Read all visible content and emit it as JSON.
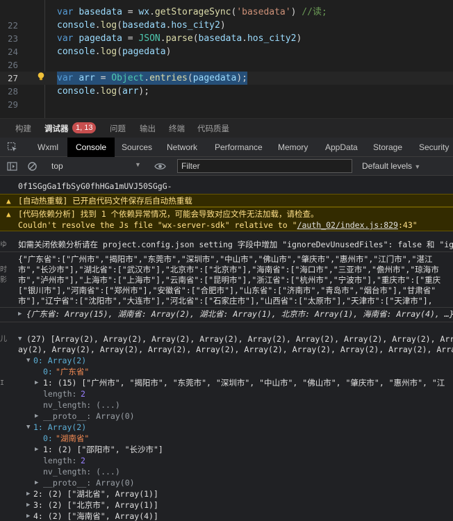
{
  "editor": {
    "lines": [
      {
        "n": "",
        "tokens": [
          [
            "k",
            "var "
          ],
          [
            "v",
            "basedata"
          ],
          [
            "p",
            " = "
          ],
          [
            "v",
            "wx"
          ],
          [
            "p",
            "."
          ],
          [
            "f",
            "getStorageSync"
          ],
          [
            "p",
            "("
          ],
          [
            "s",
            "'basedata'"
          ],
          [
            "p",
            ") "
          ],
          [
            "c",
            "//读;"
          ]
        ]
      },
      {
        "n": "22",
        "tokens": [
          [
            "v",
            "console"
          ],
          [
            "p",
            "."
          ],
          [
            "f",
            "log"
          ],
          [
            "p",
            "("
          ],
          [
            "v",
            "basedata"
          ],
          [
            "p",
            "."
          ],
          [
            "v",
            "hos_city2"
          ],
          [
            "p",
            ")"
          ]
        ]
      },
      {
        "n": "23",
        "tokens": [
          [
            "k",
            "var "
          ],
          [
            "v",
            "pagedata"
          ],
          [
            "p",
            " = "
          ],
          [
            "cls",
            "JSON"
          ],
          [
            "p",
            "."
          ],
          [
            "f",
            "parse"
          ],
          [
            "p",
            "("
          ],
          [
            "v",
            "basedata"
          ],
          [
            "p",
            "."
          ],
          [
            "v",
            "hos_city2"
          ],
          [
            "p",
            ")"
          ]
        ]
      },
      {
        "n": "24",
        "tokens": [
          [
            "v",
            "console"
          ],
          [
            "p",
            "."
          ],
          [
            "f",
            "log"
          ],
          [
            "p",
            "("
          ],
          [
            "v",
            "pagedata"
          ],
          [
            "p",
            ")"
          ]
        ]
      },
      {
        "n": "26",
        "tokens": []
      },
      {
        "n": "27",
        "tokens": [
          [
            "k",
            "var "
          ],
          [
            "v",
            "arr"
          ],
          [
            "p",
            " = "
          ],
          [
            "cls",
            "Object"
          ],
          [
            "p",
            "."
          ],
          [
            "f",
            "entries"
          ],
          [
            "p",
            "("
          ],
          [
            "v",
            "pagedata"
          ],
          [
            "p",
            ");"
          ]
        ]
      },
      {
        "n": "28",
        "tokens": [
          [
            "v",
            "console"
          ],
          [
            "p",
            "."
          ],
          [
            "f",
            "log"
          ],
          [
            "p",
            "("
          ],
          [
            "v",
            "arr"
          ],
          [
            "p",
            ");"
          ]
        ]
      },
      {
        "n": "29",
        "tokens": []
      }
    ]
  },
  "top_tabs": [
    "构建",
    "调试器",
    "问题",
    "输出",
    "终端",
    "代码质量"
  ],
  "badge": "1, 13",
  "dev_tabs": [
    "Wxml",
    "Console",
    "Sources",
    "Network",
    "Performance",
    "Memory",
    "AppData",
    "Storage",
    "Security"
  ],
  "toolbar": {
    "context": "top",
    "filter_placeholder": "Filter",
    "levels": "Default levels"
  },
  "console": {
    "l1": "0f1SGgGa1fbSyG0fhHGa1mUVJ50SGgG-",
    "l2": "[自动热重载] 已开启代码文件保存后自动热重载",
    "l3": "[代码依赖分析] 找到 1 个依赖异常情况，可能会导致对应文件无法加载，请检查。",
    "l4a": "Couldn't resolve the Js file \"wx-server-sdk\" relative to \"",
    "l4link": "/auth_02/index.js:829",
    "l4b": ":43\"",
    "l5": "如需关闭依赖分析请在 project.config.json setting 字段中增加 \"ignoreDevUnusedFiles\": false 和 \"ig",
    "json1": "{\"广东省\":[\"广州市\",\"揭阳市\",\"东莞市\",\"深圳市\",\"中山市\",\"佛山市\",\"肇庆市\",\"惠州市\",\"江门市\",\"湛江",
    "json2": "市\",\"长沙市\"],\"湖北省\":[\"武汉市\"],\"北京市\":[\"北京市\"],\"海南省\":[\"海口市\",\"三亚市\",\"儋州市\",\"琼海市",
    "json3": "市\",\"泸州市\"],\"上海市\":[\"上海市\"],\"云南省\":[\"昆明市\"],\"浙江省\":[\"杭州市\",\"宁波市\"],\"重庆市\":[\"重庆",
    "json4": "[\"银川市\"],\"河南省\":[\"郑州市\"],\"安徽省\":[\"合肥市\"],\"山东省\":[\"济南市\",\"青岛市\",\"烟台市\"],\"甘肃省\"",
    "json5": "市\"],\"辽宁省\":[\"沈阳市\",\"大连市\"],\"河北省\":[\"石家庄市\"],\"山西省\":[\"太原市\"],\"天津市\":[\"天津市\"],",
    "obj_summary": "{广东省: Array(15), 湖南省: Array(2), 湖北省: Array(1), 北京市: Array(1), 海南省: Array(4), …}",
    "arr_head1": "(27) [Array(2), Array(2), Array(2), Array(2), Array(2), Array(2), Array(2), Array(2), Array(2), Arra",
    "arr_head2": "ay(2), Array(2), Array(2), Array(2), Array(2), Array(2), Array(2), Array(2), Array(2), Array(2), Array(",
    "e0": "0: Array(2)",
    "e0_0k": "0: ",
    "e0_0v": "\"广东省\"",
    "e0_1": "1: (15) [\"广州市\", \"揭阳市\", \"东莞市\", \"深圳市\", \"中山市\", \"佛山市\", \"肇庆市\", \"惠州市\", \"江",
    "len_k": "length: ",
    "len_v": "2",
    "nv_len": "nv_length: (...)",
    "proto": "__proto__: Array(0)",
    "e1": "1: Array(2)",
    "e1_0v": "\"湖南省\"",
    "e1_1": "1: (2) [\"邵阳市\", \"长沙市\"]",
    "e2": "2: (2) [\"湖北省\", Array(1)]",
    "e3": "3: (2) [\"北京市\", Array(1)]",
    "e4": "4: (2) [\"海南省\", Array(4)]"
  }
}
